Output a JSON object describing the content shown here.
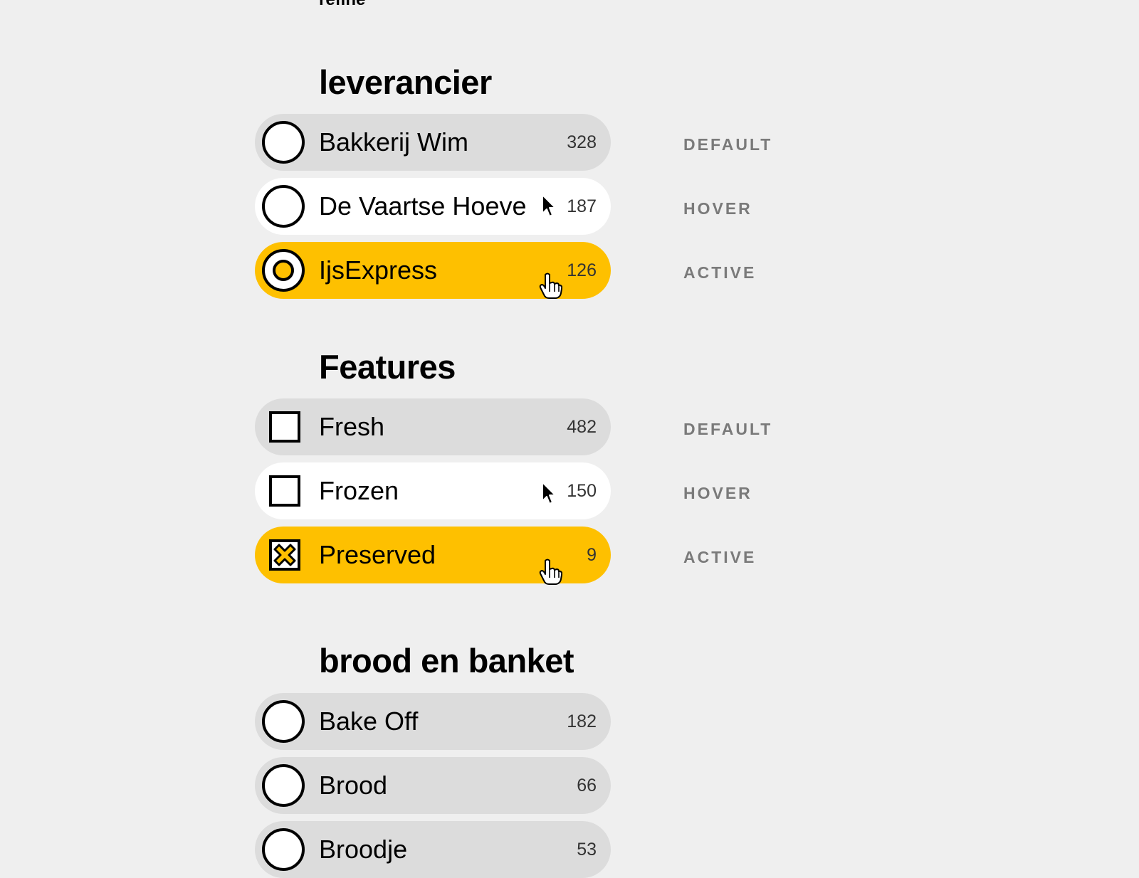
{
  "top_label": "refine",
  "sections": [
    {
      "title": "leverancier",
      "items": [
        {
          "label": "Bakkerij Wim",
          "count": "328",
          "state": "DEFAULT"
        },
        {
          "label": "De Vaartse Hoeve",
          "count": "187",
          "state": "HOVER"
        },
        {
          "label": "IjsExpress",
          "count": "126",
          "state": "ACTIVE"
        }
      ]
    },
    {
      "title": "Features",
      "items": [
        {
          "label": "Fresh",
          "count": "482",
          "state": "DEFAULT"
        },
        {
          "label": "Frozen",
          "count": "150",
          "state": "HOVER"
        },
        {
          "label": "Preserved",
          "count": "9",
          "state": "ACTIVE"
        }
      ]
    },
    {
      "title": "brood en banket",
      "items": [
        {
          "label": "Bake Off",
          "count": "182"
        },
        {
          "label": "Brood",
          "count": "66"
        },
        {
          "label": "Broodje",
          "count": "53"
        }
      ]
    }
  ],
  "colors": {
    "background": "#efefef",
    "default_pill": "#dcdcdc",
    "hover_pill": "#ffffff",
    "active_pill": "#fec000",
    "state_label": "#7a7a7a"
  },
  "icons": {
    "radio": "radio-button-icon",
    "checkbox": "checkbox-icon",
    "arrow_cursor": "arrow-cursor-icon",
    "hand_cursor": "hand-cursor-icon"
  }
}
